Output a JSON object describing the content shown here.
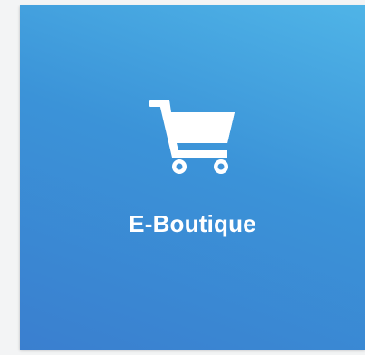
{
  "tile": {
    "label": "E-Boutique",
    "icon": "shopping-cart-icon",
    "gradient_colors": [
      "#4fb4e7",
      "#3b93d8",
      "#3a7fcf"
    ],
    "text_color": "#ffffff"
  }
}
